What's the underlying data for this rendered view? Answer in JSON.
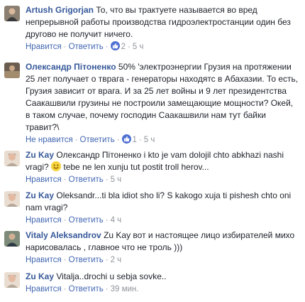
{
  "comments": [
    {
      "author": "Artush Grigorjan",
      "text": "То, что вы трактуете называется во вред непрерывной работы производства гидроэлектростанции один без другово не получит ничего.",
      "like_label": "Нравится",
      "reply_label": "Ответить",
      "likes": "2",
      "time": "5 ч"
    },
    {
      "author": "Олександр Пітоненко",
      "text": "50% 'электроэнергии Грузия на протяжении 25 лет получает о тврага - генераторы находятс в Абахазии. То есть, Грузия зависит от врага. И за 25 лет войны и 9 лет президентства Саакашвили грузины не построили замещающие мощности? Окей, в таком случае, почему господин Саакашвили нам тут байки травит?\\",
      "like_label": "Не нравится",
      "reply_label": "Ответить",
      "likes": "1",
      "time": "5 ч"
    },
    {
      "author": "Zu Kay",
      "text_before_emoji": "Олександр Пітоненко i kto je vam dolojil chto abkhazi nashi vragi?",
      "text_after_emoji": "tebe ne len xunju tut postit troll herov...",
      "like_label": "Нравится",
      "reply_label": "Ответить",
      "time": "5 ч"
    },
    {
      "author": "Zu Kay",
      "text": "Oleksandr...ti bla idiot sho li? S kakogo xuja ti pishesh chto oni nam vragi?",
      "like_label": "Нравится",
      "reply_label": "Ответить",
      "time": "4 ч"
    },
    {
      "author": "Vitaly Aleksandrov",
      "text": "Zu Kay вот и настоящее лицо избирателей михо нарисовалась , главное что не троль )))",
      "like_label": "Нравится",
      "reply_label": "Ответить",
      "time": "2 ч"
    },
    {
      "author": "Zu Kay",
      "text": "Vitalja..drochi u sebja sovke..",
      "like_label": "Нравится",
      "reply_label": "Ответить",
      "time": "39 мин."
    }
  ],
  "colors": {
    "author": "#365899",
    "link": "#4267b2",
    "meta": "#90949c",
    "like_badge": "#4e6fd2"
  }
}
